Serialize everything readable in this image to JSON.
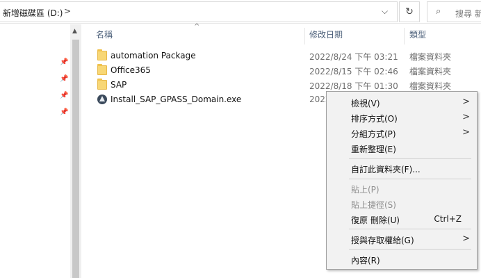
{
  "address": {
    "path": "新增磁碟區 (D:)",
    "separator": ">",
    "dropdown": "⌵",
    "refresh": "↻",
    "search_icon": "⌕",
    "search_placeholder": "搜尋 新"
  },
  "columns": {
    "sort_indicator": "^",
    "name": "名稱",
    "date": "修改日期",
    "type": "類型"
  },
  "pins": [
    "📌",
    "📌",
    "📌",
    "📌"
  ],
  "nav_scroll_up": "▲",
  "files": [
    {
      "name": "automation Package",
      "date": "2022/8/24 下午 03:21",
      "type": "檔案資料夾",
      "icon": "folder-icon"
    },
    {
      "name": "Office365",
      "date": "2022/8/15 下午 02:46",
      "type": "檔案資料夾",
      "icon": "folder-icon"
    },
    {
      "name": "SAP",
      "date": "2022/8/18 下午 01:30",
      "type": "檔案資料夾",
      "icon": "folder-icon"
    },
    {
      "name": "Install_SAP_GPASS_Domain.exe",
      "date": "2022",
      "type": "",
      "icon": "app-icon"
    }
  ],
  "context_menu": {
    "view": "檢視(V)",
    "sort_by": "排序方式(O)",
    "group_by": "分組方式(P)",
    "refresh": "重新整理(E)",
    "customize": "自訂此資料夾(F)...",
    "paste": "貼上(P)",
    "paste_shortcut": "貼上捷徑(S)",
    "undo_delete": "復原 刪除(U)",
    "undo_shortcut": "Ctrl+Z",
    "give_access": "授與存取權給(G)",
    "properties": "內容(R)",
    "submenu_arrow": ">"
  }
}
